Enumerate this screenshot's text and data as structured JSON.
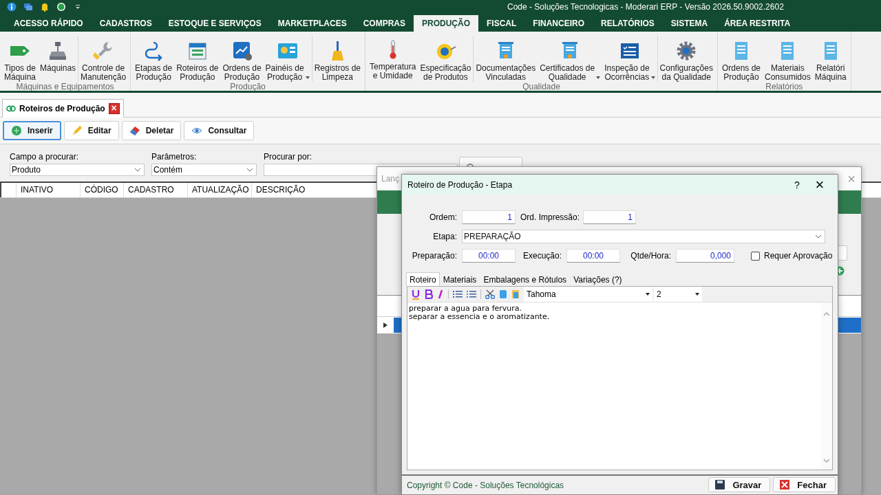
{
  "title_bar": {
    "title": "Code - Soluções Tecnologicas - Moderari ERP - Versão 2026.50.9002.2602"
  },
  "menu": [
    {
      "label": "ACESSO RÁPIDO",
      "selected": false
    },
    {
      "label": "CADASTROS",
      "selected": false
    },
    {
      "label": "ESTOQUE E SERVIÇOS",
      "selected": false
    },
    {
      "label": "MARKETPLACES",
      "selected": false
    },
    {
      "label": "COMPRAS",
      "selected": false
    },
    {
      "label": "PRODUÇÃO",
      "selected": true
    },
    {
      "label": "FISCAL",
      "selected": false
    },
    {
      "label": "FINANCEIRO",
      "selected": false
    },
    {
      "label": "RELATÓRIOS",
      "selected": false
    },
    {
      "label": "SISTEMA",
      "selected": false
    },
    {
      "label": "ÁREA RESTRITA",
      "selected": false
    }
  ],
  "ribbon": {
    "groups": [
      {
        "label": "Máquinas e Equipamentos",
        "sections": [
          [
            {
              "label": "Tipos de\nMáquina",
              "dropdown": false
            },
            {
              "label": "Máquinas",
              "dropdown": false
            }
          ],
          [
            {
              "label": "Controle de\nManutenção",
              "dropdown": false
            }
          ]
        ]
      },
      {
        "label": "Produção",
        "sections": [
          [
            {
              "label": "Etapas de\nProdução",
              "dropdown": false
            },
            {
              "label": "Roteiros de\nProdução",
              "dropdown": false
            },
            {
              "label": "Ordens de\nProdução",
              "dropdown": false
            },
            {
              "label": "Painéis de\nProdução",
              "dropdown": true
            }
          ],
          [
            {
              "label": "Registros de\nLimpeza",
              "dropdown": false
            }
          ]
        ]
      },
      {
        "label": "Qualidade",
        "sections": [
          [
            {
              "label": "Temperatura\ne Umidade",
              "dropdown": false
            },
            {
              "label": "Especificação\nde Produtos",
              "dropdown": false
            }
          ],
          [
            {
              "label": "Documentações\nVinculadas",
              "dropdown": false
            },
            {
              "label": "Certificados de\nQualidade",
              "dropdown": true
            },
            {
              "label": "Inspeção de\nOcorrências",
              "dropdown": true
            }
          ],
          [
            {
              "label": "Configurações\nda Qualidade",
              "dropdown": false
            }
          ]
        ]
      },
      {
        "label": "Relatórios",
        "sections": [
          [
            {
              "label": "Ordens de\nProdução",
              "dropdown": false
            },
            {
              "label": "Materiais\nConsumidos",
              "dropdown": false
            },
            {
              "label": "Relatóri\nMáquina",
              "dropdown": false
            }
          ]
        ]
      }
    ]
  },
  "document_tab": {
    "title": "Roteiros de Produção",
    "close": "×"
  },
  "toolbar": [
    {
      "label": "Inserir",
      "focused": true
    },
    {
      "label": "Editar",
      "focused": false
    },
    {
      "label": "Deletar",
      "focused": false
    },
    {
      "label": "Consultar",
      "focused": false
    }
  ],
  "search": {
    "fields": [
      {
        "label": "Campo a procurar:",
        "kind": "select",
        "value": "Produto"
      },
      {
        "label": "Parâmetros:",
        "kind": "select",
        "value": "Contém"
      },
      {
        "label": "Procurar por:",
        "kind": "text"
      }
    ]
  },
  "grid": {
    "columns": [
      "INATIVO",
      "CÓDIGO",
      "CADASTRO",
      "ATUALIZAÇÃO",
      "DESCRIÇÃO"
    ]
  },
  "back_dialog": {
    "title": "Lanç",
    "close": "×"
  },
  "etapa_dialog": {
    "title": "Roteiro de Produção - Etapa",
    "help": "?",
    "close": "×",
    "ordem": {
      "label": "Ordem:",
      "value": "1"
    },
    "ord_impressao": {
      "label": "Ord. Impressão:",
      "value": "1"
    },
    "etapa": {
      "label": "Etapa:",
      "value": "PREPARAÇÃO"
    },
    "preparacao": {
      "label": "Preparação:",
      "value": "00:00"
    },
    "execucao": {
      "label": "Execução:",
      "value": "00:00"
    },
    "qtde_hora": {
      "label": "Qtde/Hora:",
      "value": "0,000"
    },
    "requer_aprovacao": {
      "label": "Requer Aprovação",
      "checked": false
    },
    "tabs": [
      {
        "label": "Roteiro",
        "selected": true
      },
      {
        "label": "Materiais",
        "selected": false
      },
      {
        "label": "Embalagens e Rótulos",
        "selected": false
      },
      {
        "label": "Variações (?)",
        "selected": false
      }
    ],
    "editor": {
      "font": "Tahoma",
      "size": "2",
      "lines": [
        "preparar a agua para fervura.",
        "separar a essencia e o aromatizante."
      ]
    },
    "copyright": "Copyright © Code - Soluções Tecnológicas",
    "buttons": [
      {
        "label": "Gravar"
      },
      {
        "label": "Fechar"
      }
    ]
  }
}
